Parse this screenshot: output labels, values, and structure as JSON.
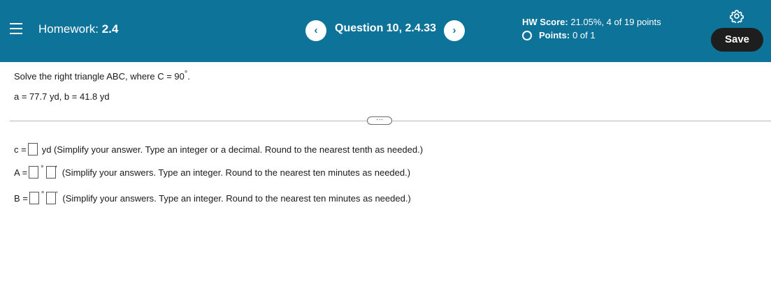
{
  "header": {
    "homework_label": "Homework:",
    "homework_number": "2.4",
    "question_title": "Question 10, 2.4.33",
    "prev_glyph": "‹",
    "next_glyph": "›",
    "score_label": "HW Score:",
    "score_value": "21.05%, 4 of 19 points",
    "points_label": "Points:",
    "points_value": "0 of 1",
    "save_label": "Save"
  },
  "problem": {
    "prompt": "Solve the right triangle ABC, where C = 90",
    "degree_symbol": "°",
    "period": ".",
    "given": "a = 77.7 yd, b = 41.8 yd"
  },
  "more_button": "···",
  "answers": {
    "c_label": "c =",
    "c_hint": "yd (Simplify your answer. Type an integer or a decimal. Round to the nearest tenth as needed.)",
    "a_label": "A =",
    "a_hint": "(Simplify your answers. Type an integer. Round to the nearest ten minutes as needed.)",
    "b_label": "B =",
    "b_hint": "(Simplify your answers. Type an integer. Round to the nearest ten minutes as needed.)",
    "degree_symbol": "°",
    "minute_symbol": "'"
  },
  "colors": {
    "header_bg": "#0e7399",
    "save_bg": "#1e1e1e"
  }
}
